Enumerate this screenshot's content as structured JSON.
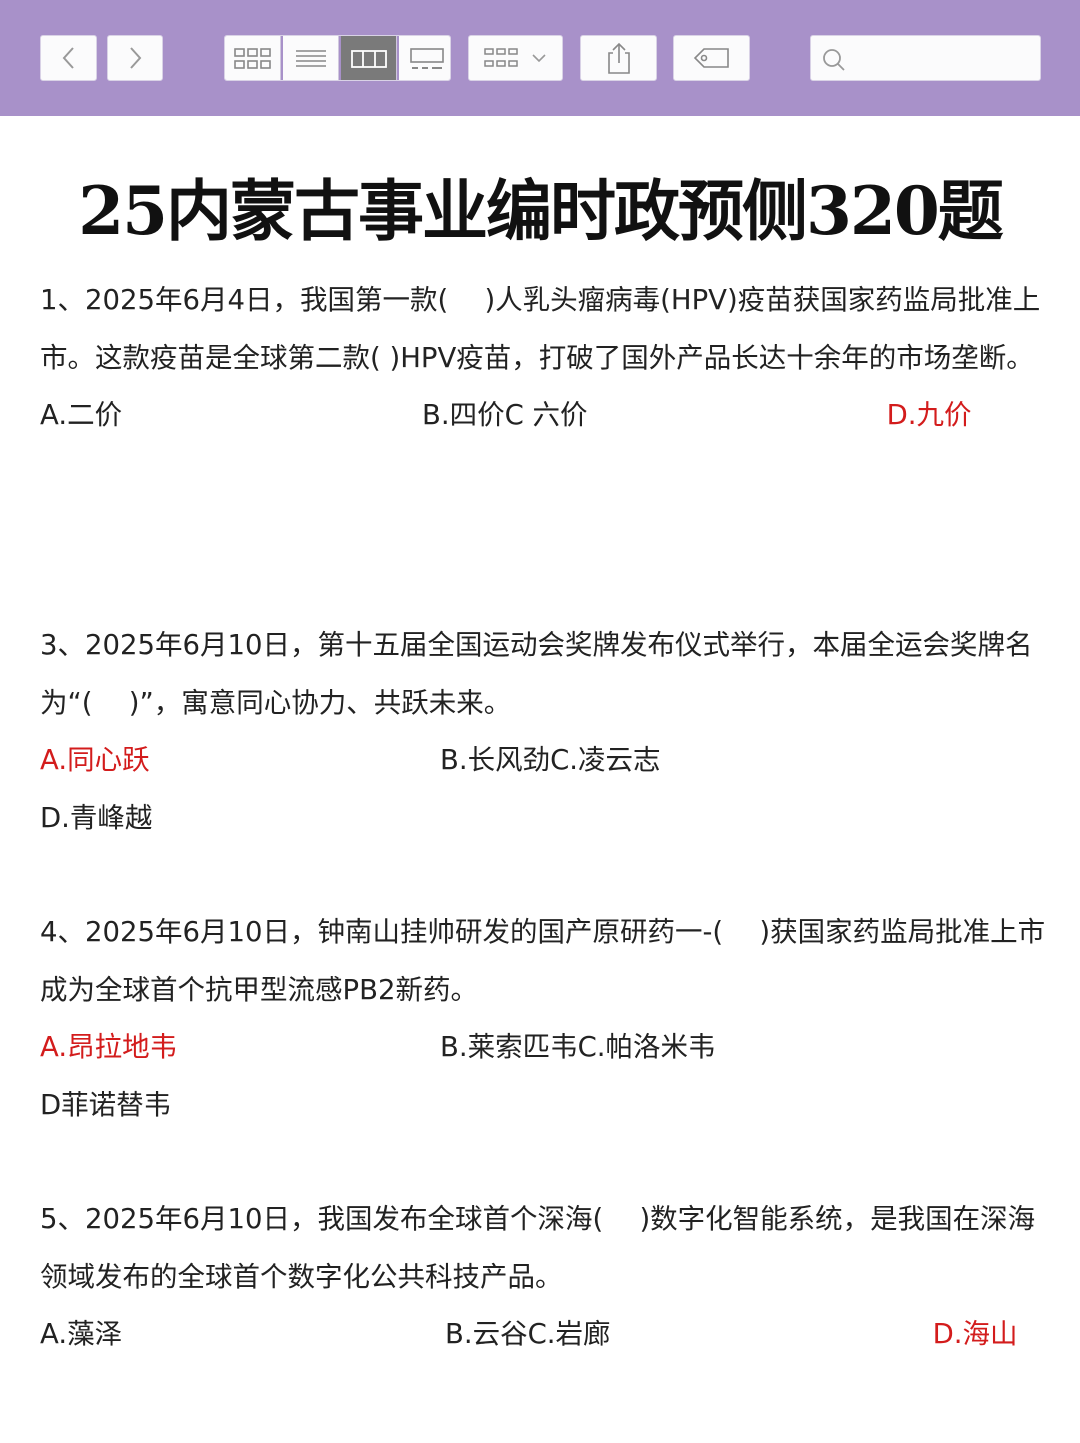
{
  "toolbar": {
    "icons": [
      "chevron-left-icon",
      "chevron-right-icon",
      "grid-view-icon",
      "list-view-icon",
      "column-view-icon",
      "gallery-view-icon",
      "group-by-icon",
      "share-icon",
      "tag-icon",
      "search-icon"
    ],
    "search_placeholder": ""
  },
  "title": "25内蒙古事业编时政预侧320题",
  "colors": {
    "toolbar": "#a891c9",
    "answer": "#d31c1c",
    "text": "#222222"
  },
  "questions": [
    {
      "stem": "1、2025年6月4日，我国第一款(　 )人乳头瘤病毒(HPV)疫苗获国家药监局批准上市。这款疫苗是全球第二款( )HPV疫苗，打破了国外产品长达十余年的市场垄断。",
      "options": [
        "A.二价",
        "B.四价",
        "C 六价",
        "D.九价"
      ],
      "answer_index": 3
    },
    {
      "stem": "3、2025年6月10日，第十五届全国运动会奖牌发布仪式举行，本届全运会奖牌名为“(　 )”，寓意同心协力、共跃未来。",
      "options": [
        "A.同心跃",
        "B.长风劲",
        "C.凌云志",
        "D.青峰越"
      ],
      "answer_index": 0
    },
    {
      "stem": "4、2025年6月10日，钟南山挂帅研发的国产原研药一-(　 )获国家药监局批准上市成为全球首个抗甲型流感PB2新药。",
      "options": [
        "A.昂拉地韦",
        "B.莱索匹韦",
        "C.帕洛米韦",
        "D菲诺替韦"
      ],
      "answer_index": 0
    },
    {
      "stem": "5、2025年6月10日，我国发布全球首个深海(　 )数字化智能系统，是我国在深海领域发布的全球首个数字化公共科技产品。",
      "options": [
        "A.藻泽",
        "B.云谷",
        "C.岩廊",
        "D.海山"
      ],
      "answer_index": 3
    }
  ]
}
